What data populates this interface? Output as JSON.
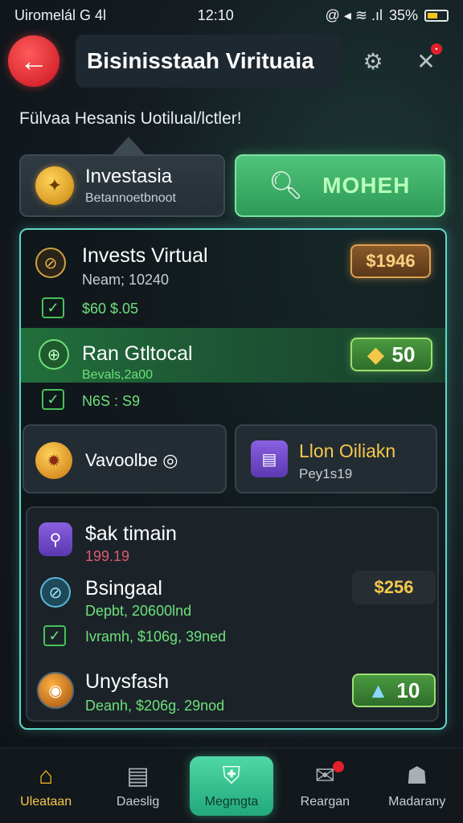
{
  "status_bar": {
    "carrier": "Uiromelál G 4l",
    "time": "12:10",
    "icons": "@ ◂ ≋ .ıl",
    "battery_text": "35%"
  },
  "header": {
    "back_icon": "arrow-left-icon",
    "title": "Bisinisstaah Virituaia",
    "settings_icon": "gear-icon",
    "tools_icon": "wrench-icon",
    "tools_badge": "•"
  },
  "subtitle": "Fülvaa Hesanis Uotilual/lctler!",
  "profile_card": {
    "name": "Investasia",
    "sub": "Betannoetbnoot",
    "icon": "coin-icon"
  },
  "search_button": {
    "label": "MOHEH",
    "icon": "magnifier-icon"
  },
  "items": {
    "invests": {
      "title": "Invests Virtual",
      "sub": "Neam; 10240",
      "check_text": "$60 $.05",
      "badge": "$1946"
    },
    "ran": {
      "title": "Ran Gtltocal",
      "sub": "Bevals,2a00",
      "check_text": "N6S : S9",
      "badge": "50"
    },
    "vavoolbe": {
      "label": "Vavoolbe ◎"
    },
    "lion": {
      "title": "Llon Oiliakn",
      "sub": "Pey1s19"
    },
    "list": [
      {
        "title": "$ak timain",
        "sub": "199.19",
        "sub_color": "#e05a6e"
      },
      {
        "title": "Bsingaal",
        "sub": "Depbt, 20600lnd",
        "badge": "$256"
      },
      {
        "title": "",
        "sub": "Ivramh, $106g, 39ned"
      },
      {
        "title": "Unysfash",
        "sub": "Deanh, $206g. 29nod",
        "badge": "10"
      }
    ]
  },
  "nav": [
    {
      "label": "Uleataan",
      "icon": "home-icon"
    },
    {
      "label": "Daeslig",
      "icon": "document-icon"
    },
    {
      "label": "Megmgta",
      "icon": "shield-check-icon"
    },
    {
      "label": "Reargan",
      "icon": "mail-icon"
    },
    {
      "label": "Madarany",
      "icon": "profile-icon"
    }
  ],
  "colors": {
    "accent_green": "#4fc47a",
    "panel_border": "#5fd6c8",
    "back_red": "#e0202a",
    "gold": "#f5b820"
  }
}
